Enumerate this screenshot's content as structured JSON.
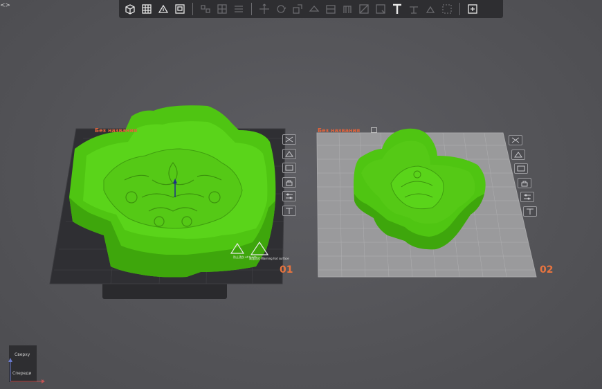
{
  "toolbar": {
    "tools": [
      {
        "name": "add-cube-icon",
        "active": true
      },
      {
        "name": "grid-icon",
        "active": true
      },
      {
        "name": "auto-orient-icon",
        "active": true
      },
      {
        "name": "arrange-icon",
        "active": true
      },
      {
        "name": "split-objects-icon",
        "active": false
      },
      {
        "name": "split-parts-icon",
        "active": false
      },
      {
        "name": "layers-icon",
        "active": false
      },
      {
        "name": "move-icon",
        "active": false
      },
      {
        "name": "rotate-icon",
        "active": false
      },
      {
        "name": "scale-icon",
        "active": false
      },
      {
        "name": "lay-on-face-icon",
        "active": false
      },
      {
        "name": "cut-icon",
        "active": false
      },
      {
        "name": "support-paint-icon",
        "active": false
      },
      {
        "name": "seam-paint-icon",
        "active": false
      },
      {
        "name": "color-paint-icon",
        "active": false
      },
      {
        "name": "text-icon",
        "active": true
      },
      {
        "name": "measure-icon",
        "active": false
      },
      {
        "name": "assembly-icon",
        "active": false
      },
      {
        "name": "boolean-icon",
        "active": false
      },
      {
        "name": "plate-icon",
        "active": true
      }
    ]
  },
  "plates": [
    {
      "title": "Без названия",
      "number": "01"
    },
    {
      "title": "Без названия",
      "number": "02"
    }
  ],
  "warning": {
    "label_left": "防止烫伤 ot touch",
    "label_right": "高温危险 Warning hot surface"
  },
  "view_cube": {
    "top_label": "Сверху",
    "front_label": "Спереди",
    "axis_x": "x"
  },
  "colors": {
    "model": "#4fc512",
    "model_dark": "#3a9a0c",
    "plate1": "#2f2f33",
    "plate2": "#9a9a9c",
    "accent": "#e8743f"
  }
}
